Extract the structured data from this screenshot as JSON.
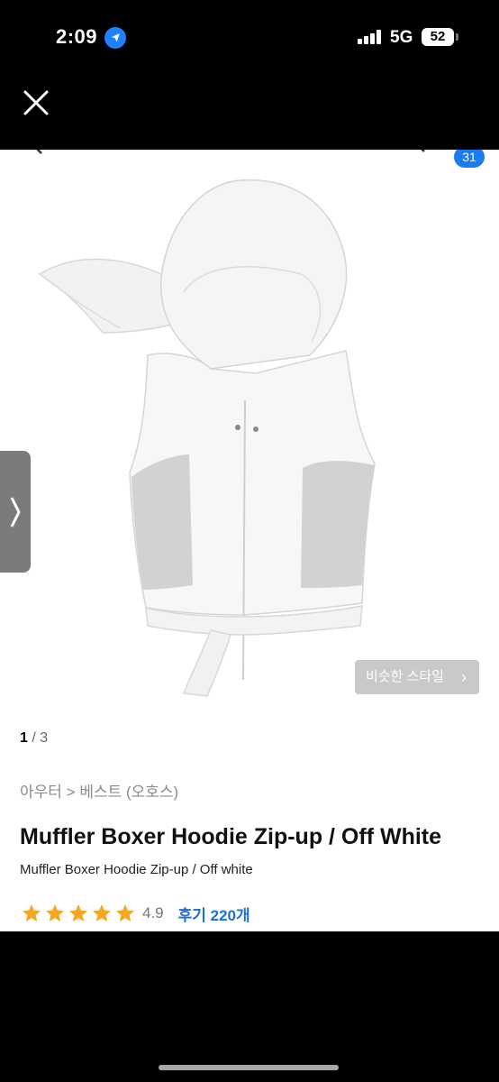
{
  "status_bar": {
    "time": "2:09",
    "network": "5G",
    "battery": "52"
  },
  "product": {
    "pager": {
      "current": "1",
      "separator": " / ",
      "total": "3"
    },
    "cart_count": "31",
    "similar_style_label": "비슷한 스타일",
    "breadcrumb": {
      "level1": "아우터",
      "separator": ">",
      "level2": "베스트 (오호스)"
    },
    "title": "Muffler Boxer Hoodie Zip-up / Off White",
    "subtitle": "Muffler Boxer Hoodie Zip-up / Off white",
    "rating": {
      "value": "4.9",
      "stars": 5,
      "reviews_label": "후기 220개"
    }
  },
  "colors": {
    "star": "#f5a623",
    "accent": "#1a7cf0",
    "link": "#1a6fd8"
  }
}
